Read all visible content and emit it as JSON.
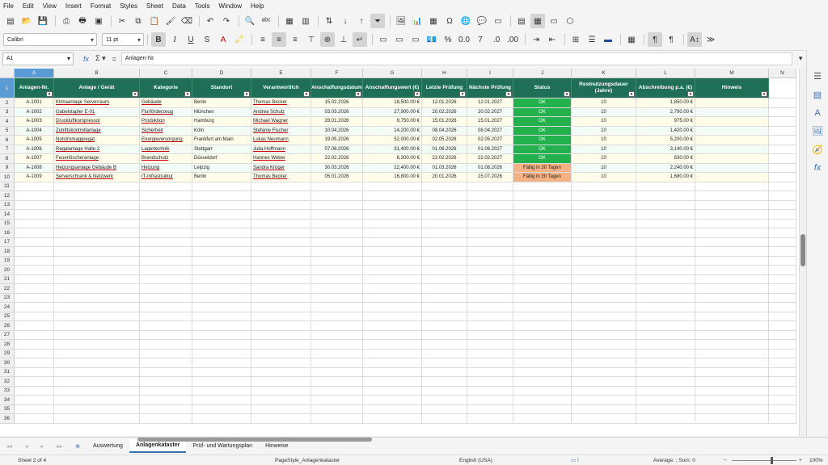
{
  "menu": [
    "File",
    "Edit",
    "View",
    "Insert",
    "Format",
    "Styles",
    "Sheet",
    "Data",
    "Tools",
    "Window",
    "Help"
  ],
  "font": {
    "name": "Calibri",
    "size": "11 pt"
  },
  "formula": {
    "cell_ref": "A1",
    "content": "Anlagen-Nr."
  },
  "columns": [
    "A",
    "B",
    "C",
    "D",
    "E",
    "F",
    "G",
    "H",
    "I",
    "J",
    "K",
    "L",
    "M",
    "N"
  ],
  "headers": [
    "Anlagen-Nr.",
    "Anlage / Gerät",
    "Kategorie",
    "Standort",
    "Verantwortlich",
    "Anschaffungsdatum",
    "Anschaffungswert (€)",
    "Letzte Prüfung",
    "Nächste Prüfung",
    "Status",
    "Restnutzungsdauer (Jahre)",
    "Abschreibung p.a. (€)",
    "Hinweis"
  ],
  "rows": [
    [
      "A-1001",
      "Klimaanlage Serverraum",
      "Gebäude",
      "Berlin",
      "Thomas Becker",
      "15.02.2026",
      "18,500.00 €",
      "12.01.2026",
      "12.01.2027",
      "OK",
      "10",
      "1,850.00 €",
      ""
    ],
    [
      "A-1002",
      "Gabelstapler E-01",
      "Flurförderzeug",
      "München",
      "Andrea Schulz",
      "03.03.2026",
      "27,900.00 €",
      "20.02.2026",
      "20.02.2027",
      "OK",
      "10",
      "2,790.00 €",
      ""
    ],
    [
      "A-1003",
      "Druckluftkompressor",
      "Produktion",
      "Hamburg",
      "Michael Wagner",
      "28.01.2026",
      "9,750.00 €",
      "15.01.2026",
      "15.01.2027",
      "OK",
      "10",
      "975.00 €",
      ""
    ],
    [
      "A-1004",
      "Zutrittskontrollanlage",
      "Sicherheit",
      "Köln",
      "Stefanie Fischer",
      "10.04.2026",
      "14,200.00 €",
      "08.04.2026",
      "08.04.2027",
      "OK",
      "10",
      "1,420.00 €",
      ""
    ],
    [
      "A-1005",
      "Notstromaggregat",
      "Energieversorgung",
      "Frankfurt am Main",
      "Lukas Neumann",
      "19.05.2026",
      "52,000.00 €",
      "02.05.2026",
      "02.05.2027",
      "OK",
      "10",
      "5,200.00 €",
      ""
    ],
    [
      "A-1006",
      "Regalanlage Halle 2",
      "Lagertechnik",
      "Stuttgart",
      "Julia Hoffmann",
      "07.06.2026",
      "31,400.00 €",
      "01.06.2026",
      "01.06.2027",
      "OK",
      "10",
      "3,140.00 €",
      ""
    ],
    [
      "A-1007",
      "Feuerlöscheranlage",
      "Brandschutz",
      "Düsseldorf",
      "Hannes Weber",
      "22.02.2026",
      "6,300.00 €",
      "22.02.2026",
      "22.02.2027",
      "OK",
      "10",
      "630.00 €",
      ""
    ],
    [
      "A-1008",
      "Heizungsanlage Gebäude B",
      "Heizung",
      "Leipzig",
      "Sandra Krüger",
      "30.03.2026",
      "22,400.00 €",
      "01.03.2026",
      "01.08.2026",
      "Fällig in 30 Tagen",
      "10",
      "2,240.00 €",
      ""
    ],
    [
      "A-1009",
      "Serverschrank & Netzwerk",
      "IT-Infrastruktur",
      "Berlin",
      "Thomas Becker",
      "05.01.2026",
      "16,800.00 €",
      "20.01.2026",
      "15.07.2026",
      "Fällig in 30 Tagen",
      "10",
      "1,680.00 €",
      ""
    ]
  ],
  "status_colors": {
    "ok": "#22b14c",
    "due": "#f4b183",
    "header": "#1e6f55"
  },
  "tabs": [
    "Auswertung",
    "Anlagenkataster",
    "Prüf- und Wartungsplan",
    "Hinweise"
  ],
  "active_tab": "Anlagenkataster",
  "statusbar": {
    "sheet": "Sheet 2 of 4",
    "pagestyle": "PageStyle_Anlagenkataster",
    "language": "English (USA)",
    "summary": "Average: ; Sum: 0",
    "zoom": "100%"
  }
}
